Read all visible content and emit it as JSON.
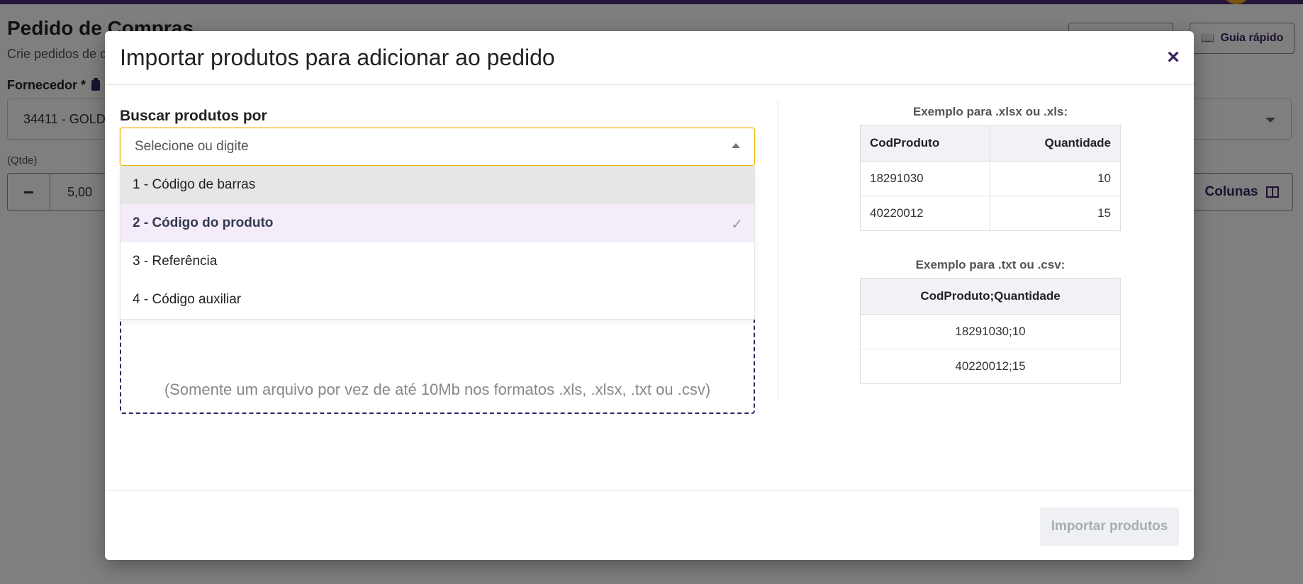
{
  "background": {
    "page_title": "Pedido de Compras",
    "page_subtitle": "Crie pedidos de c",
    "guide_button": "Guia rápido",
    "supplier_label": "Fornecedor *",
    "supplier_value": "34411 - GOLD",
    "qty_label": "(Qtde)",
    "qty_value": "5,00",
    "qty_minus": "−",
    "columns_button": "Colunas"
  },
  "modal": {
    "title": "Importar produtos para adicionar ao pedido",
    "close_symbol": "×",
    "search_label": "Buscar produtos por",
    "search_placeholder": "Selecione ou digite",
    "options": [
      {
        "label": "1 - Código de barras"
      },
      {
        "label": "2 - Código do produto"
      },
      {
        "label": "3 - Referência"
      },
      {
        "label": "4 - Código auxiliar"
      }
    ],
    "selected_mark": "✓",
    "dropzone_hint": "(Somente um arquivo por vez de até 10Mb nos formatos .xls, .xlsx, .txt ou .csv)",
    "import_button": "Importar produtos"
  },
  "examples": {
    "xlsx": {
      "title": "Exemplo para .xlsx ou .xls:",
      "headers": [
        "CodProduto",
        "Quantidade"
      ],
      "rows": [
        [
          "18291030",
          "10"
        ],
        [
          "40220012",
          "15"
        ]
      ]
    },
    "txt": {
      "title": "Exemplo para .txt ou .csv:",
      "header": "CodProduto;Quantidade",
      "rows": [
        "18291030;10",
        "40220012;15"
      ]
    }
  }
}
